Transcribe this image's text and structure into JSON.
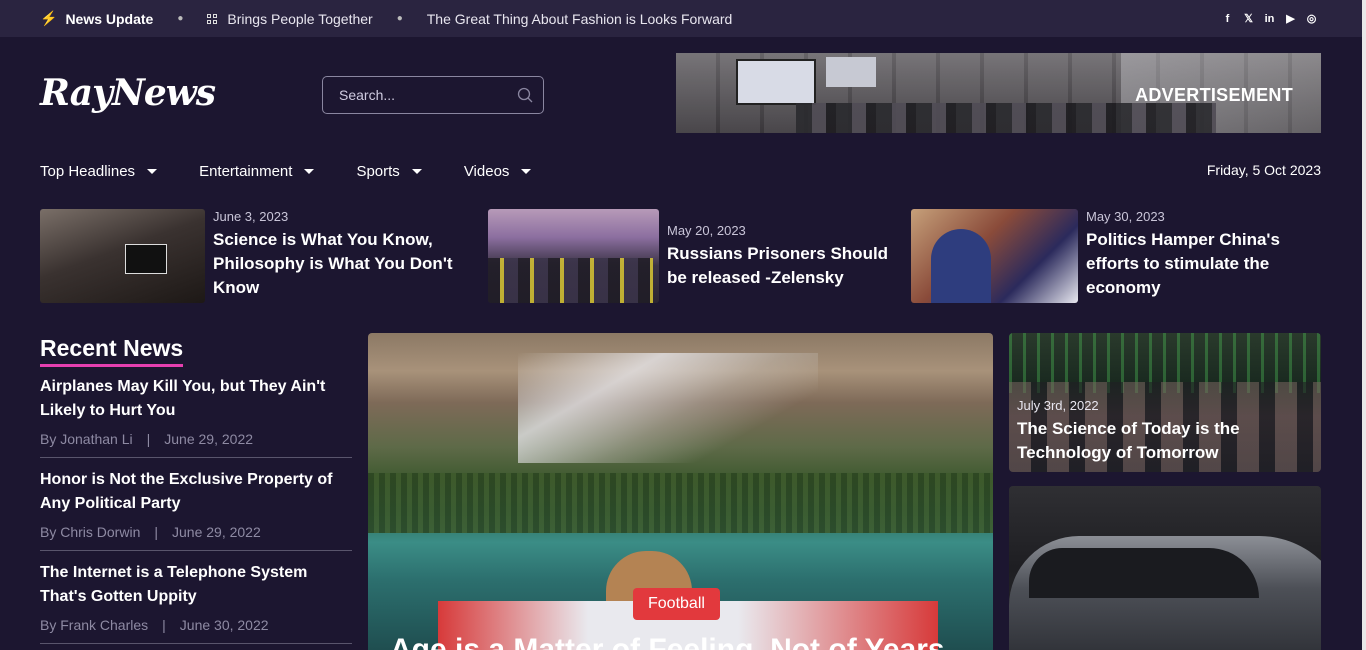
{
  "topbar": {
    "lead": "News Update",
    "items": [
      "Brings People Together",
      "The Great Thing About Fashion is Looks Forward"
    ],
    "social": [
      {
        "icon": "facebook-icon",
        "glyph": "f"
      },
      {
        "icon": "x-icon",
        "glyph": "𝕏"
      },
      {
        "icon": "linkedin-icon",
        "glyph": "in"
      },
      {
        "icon": "youtube-icon",
        "glyph": "▶"
      },
      {
        "icon": "instagram-icon",
        "glyph": "◎"
      }
    ]
  },
  "header": {
    "logo": "RayNews",
    "search_placeholder": "Search...",
    "ad_label": "ADVERTISEMENT"
  },
  "nav": {
    "items": [
      "Top Headlines",
      "Entertainment",
      "Sports",
      "Videos"
    ],
    "date": "Friday, 5 Oct 2023"
  },
  "featured": [
    {
      "date": "June 3, 2023",
      "title": "Science is What You Know, Philosophy is What You Don't Know"
    },
    {
      "date": "May 20, 2023",
      "title": "Russians Prisoners Should be released -Zelensky"
    },
    {
      "date": "May 30, 2023",
      "title": "Politics Hamper China's efforts to stimulate the economy"
    }
  ],
  "recent": {
    "heading": "Recent News",
    "items": [
      {
        "title": "Airplanes May Kill You, but They Ain't Likely to Hurt You",
        "author": "By Jonathan Li",
        "date": "June 29, 2022"
      },
      {
        "title": "Honor is Not the Exclusive Property of Any Political Party",
        "author": "By Chris Dorwin",
        "date": "June 29, 2022"
      },
      {
        "title": "The Internet is a Telephone System That's Gotten Uppity",
        "author": "By Frank Charles",
        "date": "June 30, 2022"
      }
    ]
  },
  "hero": {
    "category": "Football",
    "title": "Age is a Matter of Feeling, Not of Years"
  },
  "side": {
    "card1": {
      "date": "July 3rd, 2022",
      "title": "The Science of Today is the Technology of Tomorrow"
    }
  },
  "colors": {
    "background": "#1c1630",
    "accent": "#e63fb0",
    "category": "#e2393d"
  }
}
